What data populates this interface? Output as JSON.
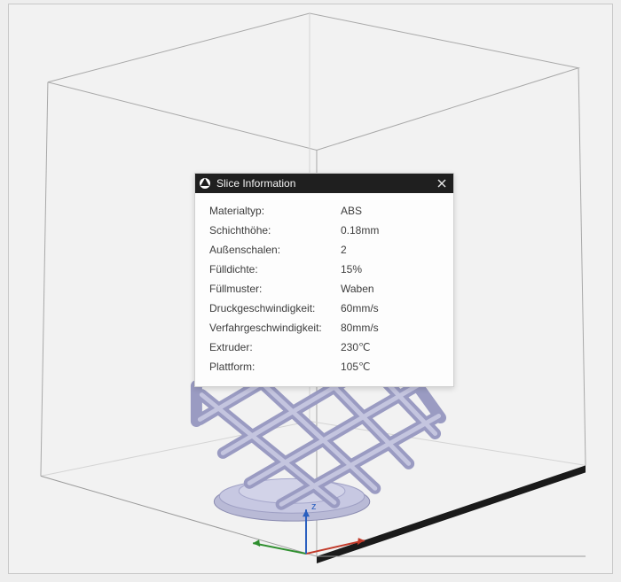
{
  "panel": {
    "title": "Slice Information",
    "rows": [
      {
        "label": "Materialtyp:",
        "value": "ABS"
      },
      {
        "label": "Schichthöhe:",
        "value": "0.18mm"
      },
      {
        "label": "Außenschalen:",
        "value": "2"
      },
      {
        "label": "Fülldichte:",
        "value": "15%"
      },
      {
        "label": "Füllmuster:",
        "value": "Waben"
      },
      {
        "label": "Druckgeschwindigkeit:",
        "value": "60mm/s"
      },
      {
        "label": "Verfahrgeschwindigkeit:",
        "value": "80mm/s"
      },
      {
        "label": "Extruder:",
        "value": "230℃"
      },
      {
        "label": "Plattform:",
        "value": "105℃"
      }
    ]
  },
  "axes": {
    "z_label": "z"
  }
}
